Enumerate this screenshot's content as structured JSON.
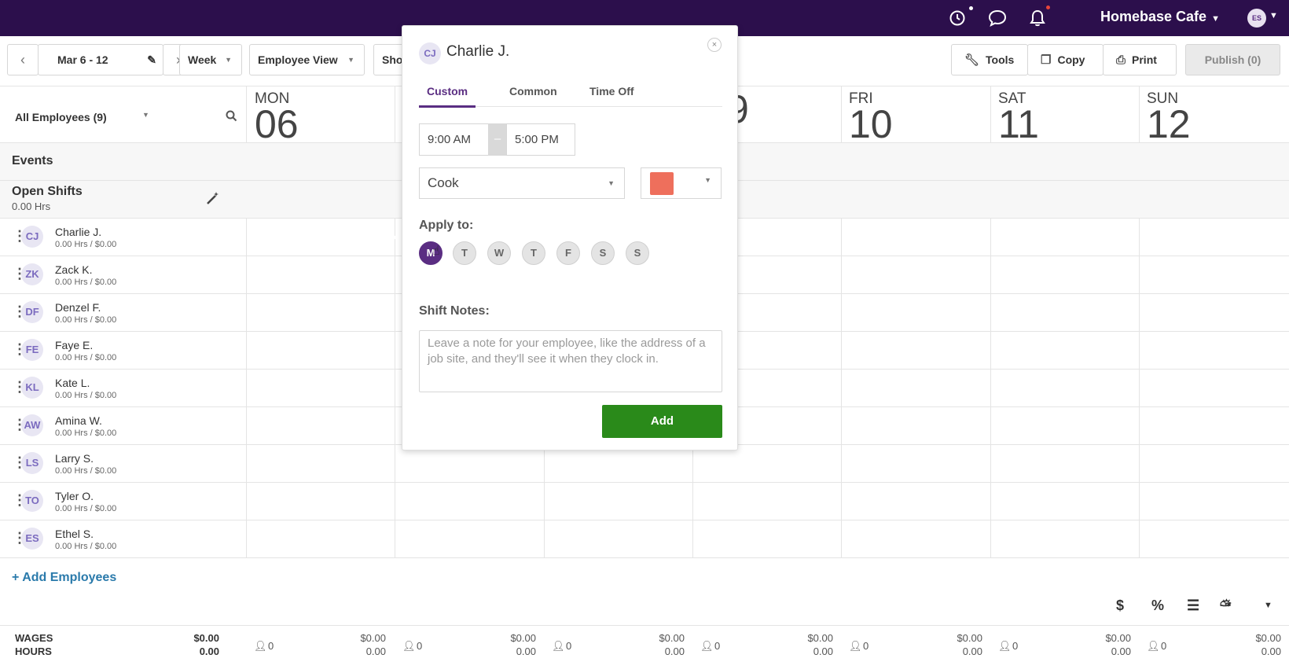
{
  "topbar": {
    "company": "Homebase Cafe",
    "user_initials": "ES",
    "icons": [
      "clock-icon",
      "chat-icon",
      "bell-icon"
    ]
  },
  "toolbar": {
    "date_range": "Mar 6 - 12",
    "period": "Week",
    "view": "Employee View",
    "show_truncated": "Sho",
    "tools": "Tools",
    "copy": "Copy",
    "print": "Print",
    "publish": "Publish (0)"
  },
  "sidebar": {
    "filter": "All Employees (9)",
    "events": "Events",
    "open_shifts": "Open Shifts",
    "open_shifts_hours": "0.00 Hrs",
    "add_employees": "+ Add Employees"
  },
  "days": [
    {
      "name": "MON",
      "num": "06"
    },
    {
      "name": "",
      "num": "9"
    },
    {
      "name": "FRI",
      "num": "10"
    },
    {
      "name": "SAT",
      "num": "11"
    },
    {
      "name": "SUN",
      "num": "12"
    }
  ],
  "employees": [
    {
      "initials": "CJ",
      "name": "Charlie J.",
      "sub": "0.00 Hrs / $0.00"
    },
    {
      "initials": "ZK",
      "name": "Zack K.",
      "sub": "0.00 Hrs / $0.00"
    },
    {
      "initials": "DF",
      "name": "Denzel F.",
      "sub": "0.00 Hrs / $0.00"
    },
    {
      "initials": "FE",
      "name": "Faye E.",
      "sub": "0.00 Hrs / $0.00"
    },
    {
      "initials": "KL",
      "name": "Kate L.",
      "sub": "0.00 Hrs / $0.00"
    },
    {
      "initials": "AW",
      "name": "Amina W.",
      "sub": "0.00 Hrs / $0.00"
    },
    {
      "initials": "LS",
      "name": "Larry S.",
      "sub": "0.00 Hrs / $0.00"
    },
    {
      "initials": "TO",
      "name": "Tyler O.",
      "sub": "0.00 Hrs / $0.00"
    },
    {
      "initials": "ES",
      "name": "Ethel S.",
      "sub": "0.00 Hrs / $0.00"
    }
  ],
  "footer": {
    "wages_label": "WAGES",
    "hours_label": "HOURS",
    "total_wages": "$0.00",
    "total_hours": "0.00",
    "day_count": "0",
    "day_wages": "$0.00",
    "day_hours": "0.00"
  },
  "modal": {
    "initials": "CJ",
    "name": "Charlie J.",
    "close": "×",
    "tabs": [
      "Custom",
      "Common",
      "Time Off"
    ],
    "start_time": "9:00 AM",
    "dash": "–",
    "end_time": "5:00 PM",
    "role": "Cook",
    "color": "#ee6f5c",
    "apply_to": "Apply to:",
    "days": [
      "M",
      "T",
      "W",
      "T",
      "F",
      "S",
      "S"
    ],
    "selected_day": "M",
    "notes_label": "Shift Notes:",
    "notes_placeholder": "Leave a note for your employee, like the address of a job site, and they'll see it when they clock in.",
    "add": "Add"
  },
  "colors": {
    "brand_purple": "#2c0f4c",
    "accent_purple": "#5a2d82",
    "add_green": "#2a8a1a",
    "link_blue": "#2a7aab"
  }
}
